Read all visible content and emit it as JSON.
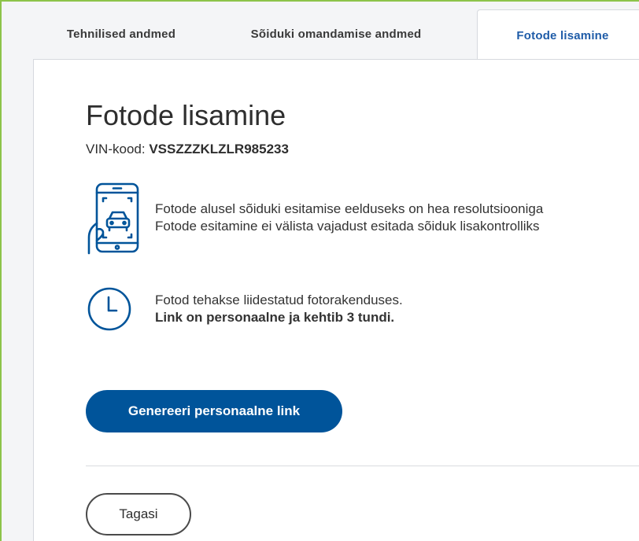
{
  "tabs": [
    {
      "label": "Tehnilised andmed"
    },
    {
      "label": "Sõiduki omandamise andmed"
    },
    {
      "label": "Fotode lisamine"
    }
  ],
  "page": {
    "title": "Fotode lisamine",
    "vin_label": "VIN-kood:",
    "vin_value": "VSSZZZKLZLR985233"
  },
  "info1": {
    "icon": "phone-car-icon",
    "line1": "Fotode alusel sõiduki esitamise eelduseks on hea resolutsiooniga",
    "line2": "Fotode esitamine ei välista vajadust esitada sõiduk lisakontrolliks"
  },
  "info2": {
    "icon": "clock-icon",
    "line1": "Fotod tehakse liidestatud fotorakenduses.",
    "line2": "Link on personaalne ja kehtib 3 tundi."
  },
  "actions": {
    "generate_label": "Genereeri personaalne link",
    "back_label": "Tagasi"
  },
  "colors": {
    "accent": "#00549a",
    "active_tab_text": "#1f5ca8",
    "frame_border": "#8dc44a"
  }
}
